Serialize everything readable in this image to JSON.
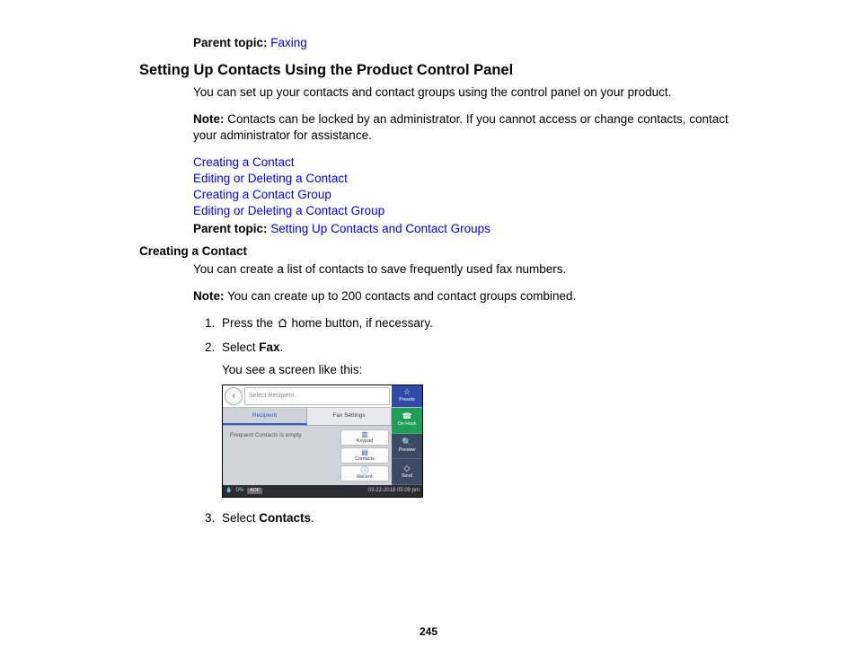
{
  "top_parent": {
    "label": "Parent topic:",
    "link": "Faxing"
  },
  "section_title": "Setting Up Contacts Using the Product Control Panel",
  "intro": "You can set up your contacts and contact groups using the control panel on your product.",
  "note1_label": "Note:",
  "note1_text": " Contacts can be locked by an administrator. If you cannot access or change contacts, contact your administrator for assistance.",
  "links": [
    "Creating a Contact",
    "Editing or Deleting a Contact",
    "Creating a Contact Group",
    "Editing or Deleting a Contact Group"
  ],
  "parent2": {
    "label": "Parent topic:",
    "link": "Setting Up Contacts and Contact Groups"
  },
  "subheading": "Creating a Contact",
  "sub_intro": "You can create a list of contacts to save frequently used fax numbers.",
  "note2_label": "Note:",
  "note2_text": " You can create up to 200 contacts and contact groups combined.",
  "steps": {
    "s1a": "Press the ",
    "s1b": " home button, if necessary.",
    "s2a": "Select ",
    "s2b": "Fax",
    "s2c": ".",
    "s2_sub": "You see a screen like this:",
    "s3a": "Select ",
    "s3b": "Contacts",
    "s3c": "."
  },
  "screenshot": {
    "placeholder": "Select Recipient.",
    "tab_recipient": "Recipient",
    "tab_settings": "Fax Settings",
    "btn_keypad": "Keypad",
    "btn_contacts": "Contacts",
    "btn_recent": "Recent",
    "empty_text": "Frequent Contacts is empty.",
    "side_presets": "Presets",
    "side_onhook": "On Hook",
    "side_preview": "Preview",
    "side_send": "Send",
    "status_pct": "0%",
    "status_adf": "ADF",
    "status_time": "03-22-2018 05:09 pm"
  },
  "page_number": "245"
}
